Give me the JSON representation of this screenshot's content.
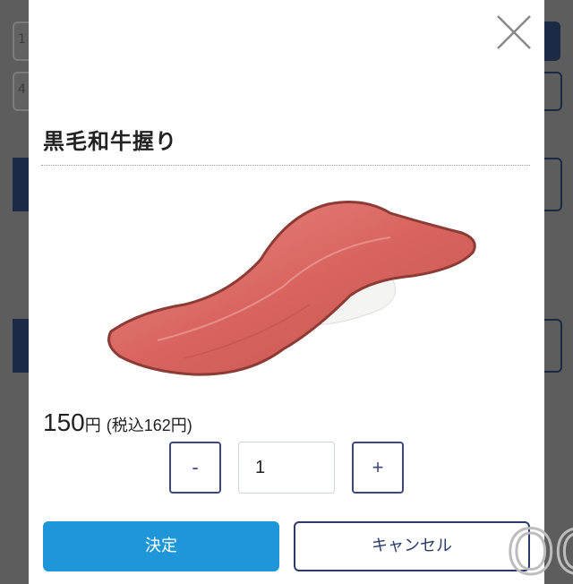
{
  "background": {
    "field_1_value": "1",
    "field_2_value": "4"
  },
  "modal": {
    "title": "黒毛和牛握り",
    "price": {
      "amount": "150",
      "currency": "円",
      "tax_included": "(税込162円)"
    },
    "quantity": {
      "minus_label": "-",
      "value": "1",
      "plus_label": "+"
    },
    "confirm_label": "決定",
    "cancel_label": "キャンセル",
    "close_icon": "close-icon",
    "image": "wagyu-nigiri-sushi-photo"
  },
  "watermark": "OG",
  "colors": {
    "overlay": "#5d5d5d",
    "primary_button": "#1e96d8",
    "navy": "#2b3a6a"
  }
}
